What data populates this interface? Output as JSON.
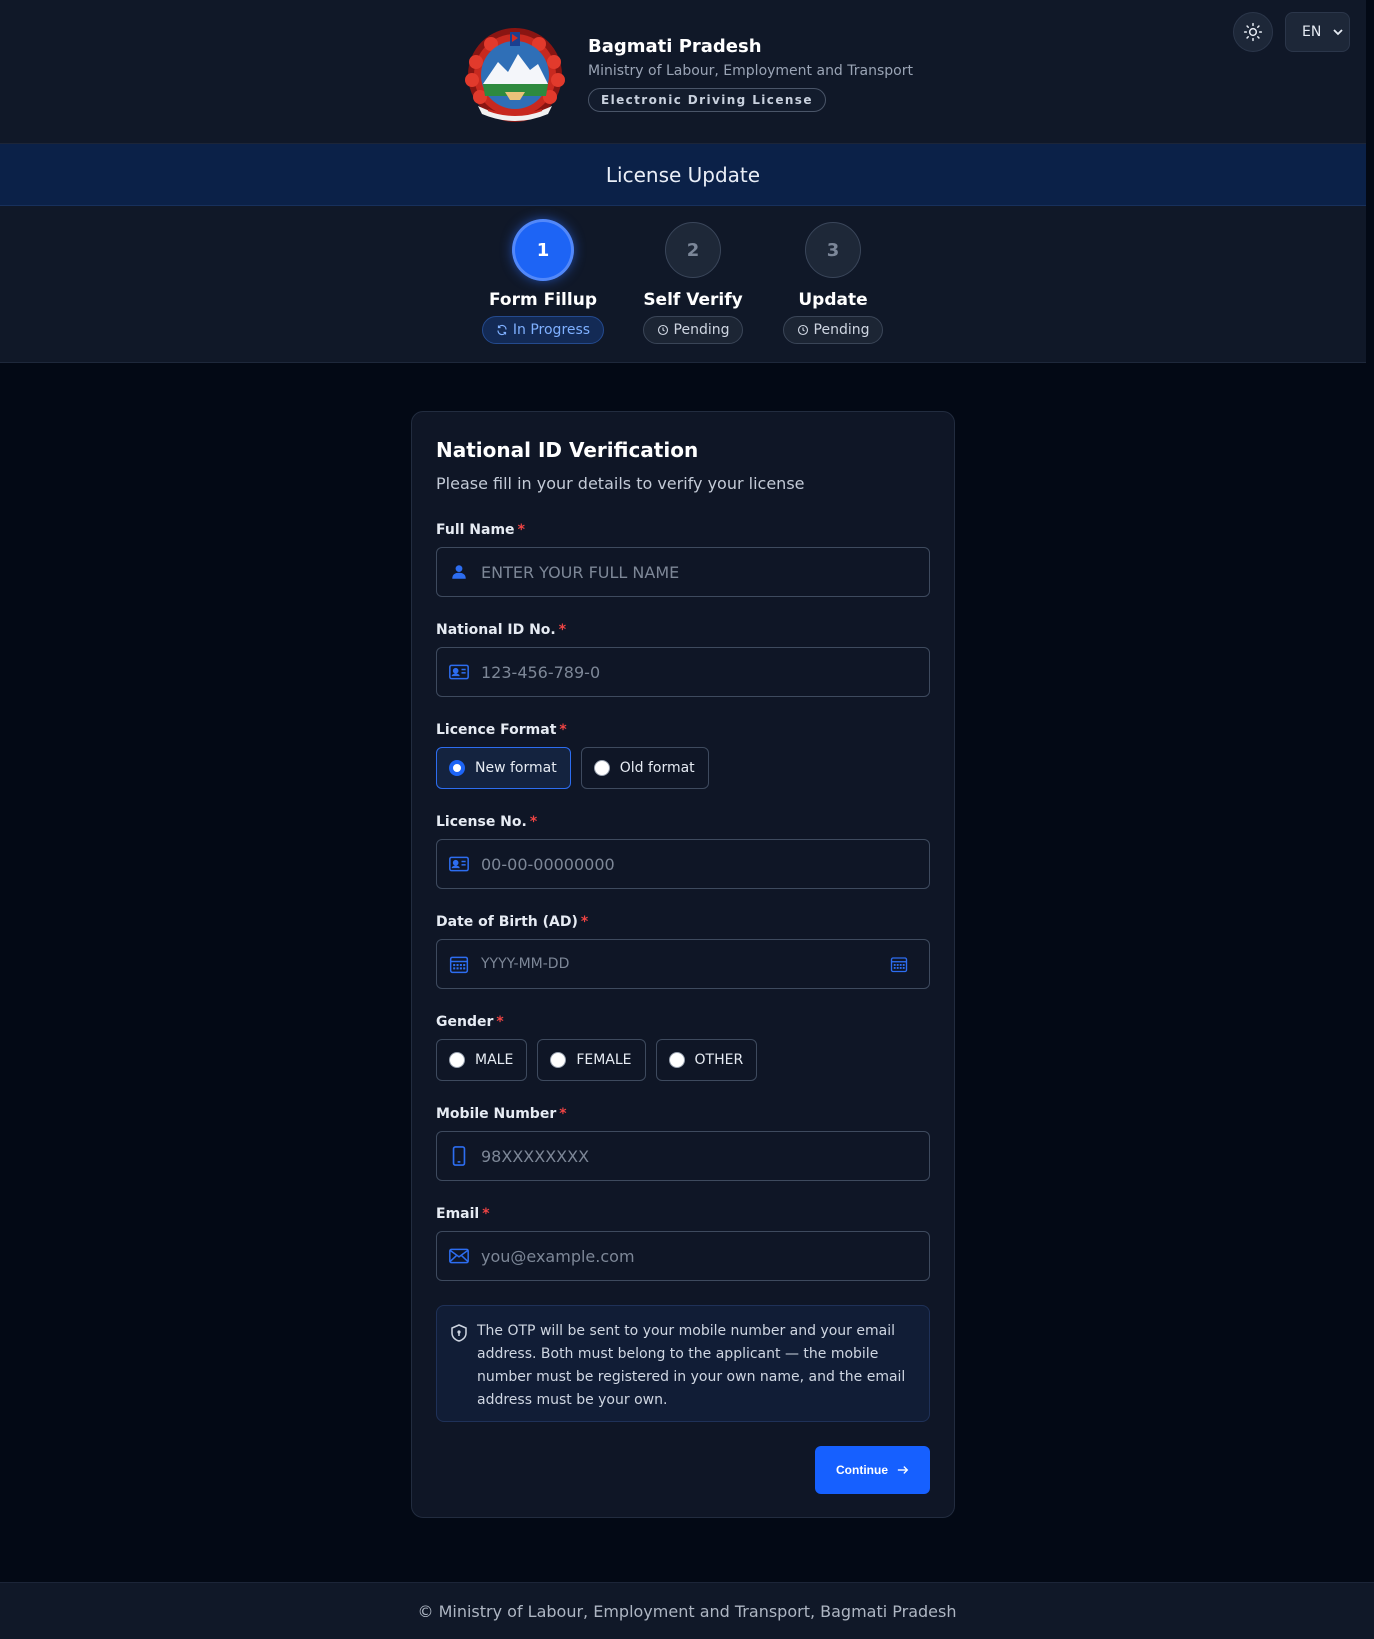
{
  "header": {
    "title": "Bagmati Pradesh",
    "subtitle": "Ministry of Labour, Employment and Transport",
    "badge": "Electronic Driving License",
    "language": "EN"
  },
  "page_title": "License Update",
  "steps": [
    {
      "number": "1",
      "label": "Form Fillup",
      "status": "In Progress"
    },
    {
      "number": "2",
      "label": "Self Verify",
      "status": "Pending"
    },
    {
      "number": "3",
      "label": "Update",
      "status": "Pending"
    }
  ],
  "form": {
    "title": "National ID Verification",
    "subtitle": "Please fill in your details to verify your license",
    "full_name": {
      "label": "Full Name",
      "placeholder": "ENTER YOUR FULL NAME"
    },
    "national_id": {
      "label": "National ID No.",
      "placeholder": "123-456-789-0"
    },
    "licence_format": {
      "label": "Licence Format",
      "options": [
        "New format",
        "Old format"
      ],
      "selected": "New format"
    },
    "license_no": {
      "label": "License No.",
      "placeholder": "00-00-00000000"
    },
    "dob": {
      "label": "Date of Birth (AD)",
      "placeholder": "YYYY-MM-DD"
    },
    "gender": {
      "label": "Gender",
      "options": [
        "MALE",
        "FEMALE",
        "OTHER"
      ]
    },
    "mobile": {
      "label": "Mobile Number",
      "placeholder": "98XXXXXXXX"
    },
    "email": {
      "label": "Email",
      "placeholder": "you@example.com"
    },
    "required_mark": "*",
    "notice": "The OTP will be sent to your mobile number and your email address. Both must belong to the applicant — the mobile number must be registered in your own name, and the email address must be your own.",
    "continue_label": "Continue"
  },
  "footer": "© Ministry of Labour, Employment and Transport, Bagmati Pradesh",
  "colors": {
    "accent": "#1660ff",
    "background": "#030915",
    "header": "#101828",
    "title_bar": "#0b2148",
    "required": "#ef4444"
  }
}
